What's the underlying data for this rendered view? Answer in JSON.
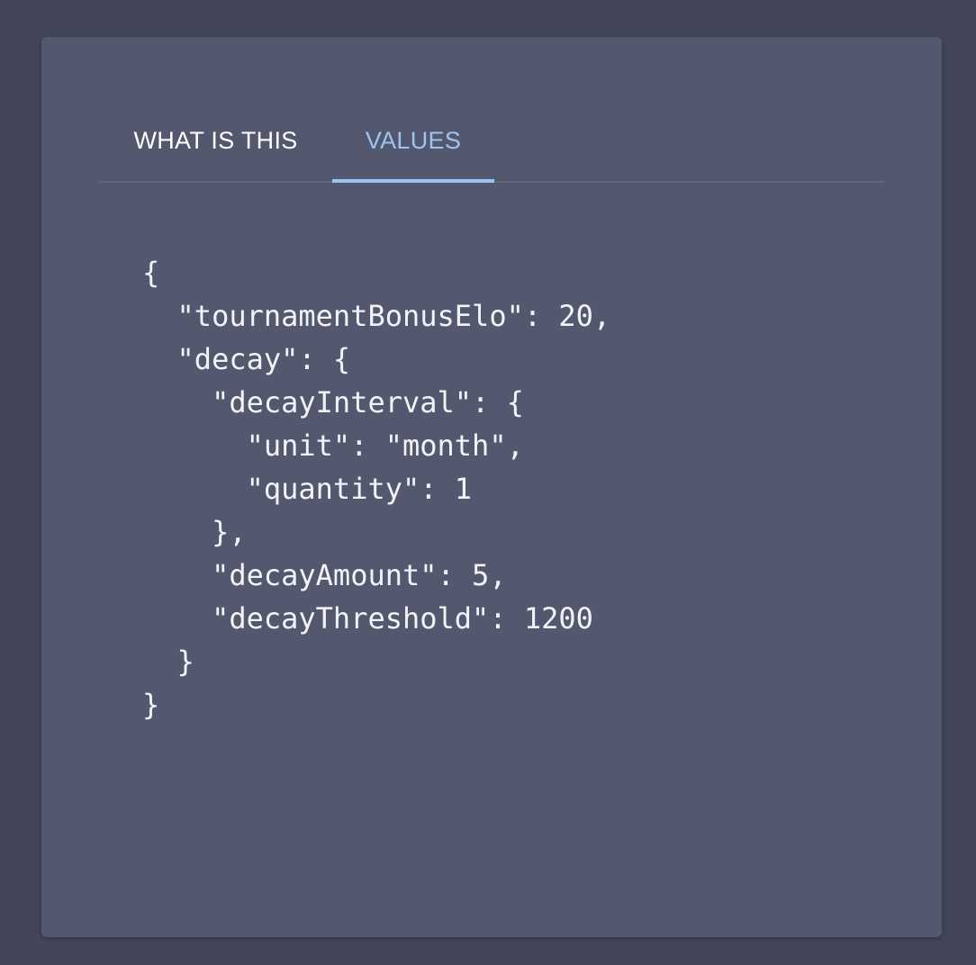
{
  "tabs": [
    {
      "label": "WHAT IS THIS",
      "active": false
    },
    {
      "label": "VALUES",
      "active": true
    }
  ],
  "code_lines": [
    "{",
    "  \"tournamentBonusElo\": 20,",
    "  \"decay\": {",
    "    \"decayInterval\": {",
    "      \"unit\": \"month\",",
    "      \"quantity\": 1",
    "    },",
    "    \"decayAmount\": 5,",
    "    \"decayThreshold\": 1200",
    "  }",
    "}"
  ],
  "colors": {
    "background": "#434659",
    "card": "#53586f",
    "accent": "#9dc4f0",
    "text": "#f2f3f7"
  }
}
